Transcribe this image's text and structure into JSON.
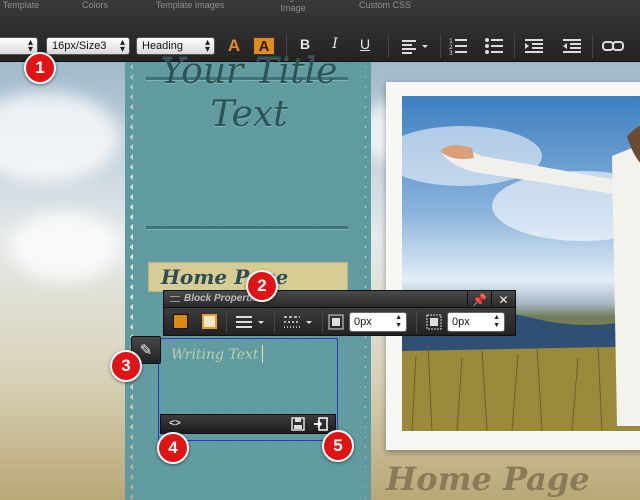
{
  "toolbar": {
    "menu_tabs": [
      "Template",
      "Colors",
      "Template Images",
      "Background Image",
      "Custom CSS"
    ],
    "font_family_value": "",
    "font_size_value": "16px/Size3",
    "block_style_value": "Heading",
    "text_color_glyph": "A",
    "highlight_glyph": "A",
    "bold_glyph": "B",
    "italic_glyph": "I",
    "underline_glyph": "U",
    "accent_color": "#e8891b"
  },
  "page": {
    "site_title": "Your Title Text",
    "nav_item": "Home Page",
    "section_heading": "Home Page",
    "ribbon_color": "#5e9a9f"
  },
  "block_properties": {
    "title": "Block Properties",
    "padding_value": "0px",
    "margin_value": "0px",
    "swatch_1": "#d98a10",
    "swatch_2": "#e4a028"
  },
  "editor": {
    "text": "Writing Text",
    "code_glyph": "<>"
  },
  "callouts": [
    "1",
    "2",
    "3",
    "4",
    "5"
  ]
}
